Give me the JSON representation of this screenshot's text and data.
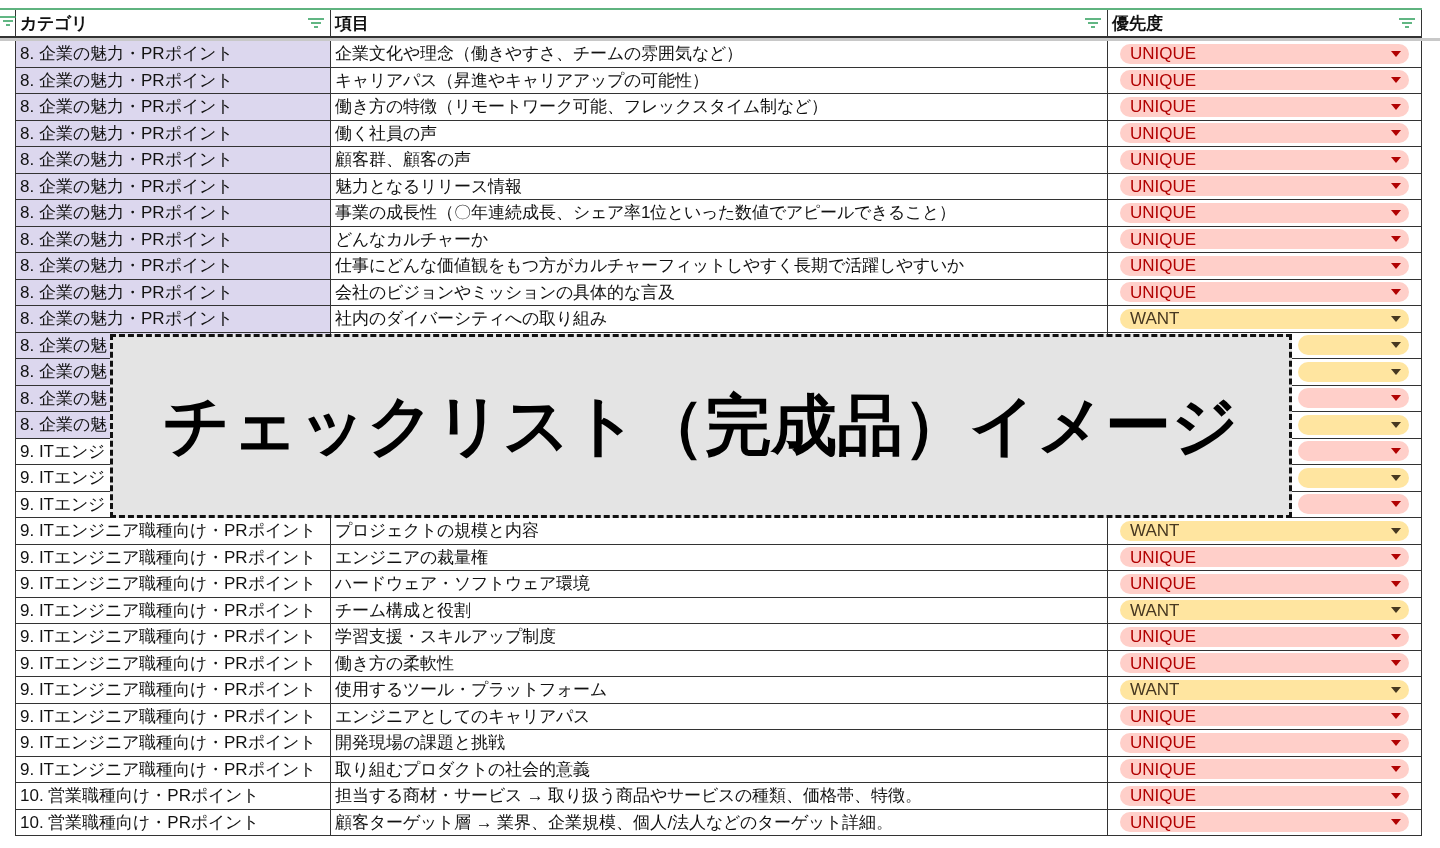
{
  "columns": [
    {
      "label": "カテゴリ"
    },
    {
      "label": "項目"
    },
    {
      "label": "優先度"
    }
  ],
  "rows": [
    {
      "category": "8. 企業の魅力・PRポイント",
      "color": "#dcd7ee",
      "item": "企業文化や理念（働きやすさ、チームの雰囲気など）",
      "priority": {
        "kind": "unique",
        "label": "UNIQUE"
      }
    },
    {
      "category": "8. 企業の魅力・PRポイント",
      "color": "#dcd7ee",
      "item": "キャリアパス（昇進やキャリアアップの可能性）",
      "priority": {
        "kind": "unique",
        "label": "UNIQUE"
      }
    },
    {
      "category": "8. 企業の魅力・PRポイント",
      "color": "#dcd7ee",
      "item": "働き方の特徴（リモートワーク可能、フレックスタイム制など）",
      "priority": {
        "kind": "unique",
        "label": "UNIQUE"
      }
    },
    {
      "category": "8. 企業の魅力・PRポイント",
      "color": "#dcd7ee",
      "item": "働く社員の声",
      "priority": {
        "kind": "unique",
        "label": "UNIQUE"
      }
    },
    {
      "category": "8. 企業の魅力・PRポイント",
      "color": "#dcd7ee",
      "item": "顧客群、顧客の声",
      "priority": {
        "kind": "unique",
        "label": "UNIQUE"
      }
    },
    {
      "category": "8. 企業の魅力・PRポイント",
      "color": "#dcd7ee",
      "item": "魅力となるリリース情報",
      "priority": {
        "kind": "unique",
        "label": "UNIQUE"
      }
    },
    {
      "category": "8. 企業の魅力・PRポイント",
      "color": "#dcd7ee",
      "item": "事業の成長性（〇年連続成長、シェア率1位といった数値でアピールできること）",
      "priority": {
        "kind": "unique",
        "label": "UNIQUE"
      }
    },
    {
      "category": "8. 企業の魅力・PRポイント",
      "color": "#dcd7ee",
      "item": "どんなカルチャーか",
      "priority": {
        "kind": "unique",
        "label": "UNIQUE"
      }
    },
    {
      "category": "8. 企業の魅力・PRポイント",
      "color": "#dcd7ee",
      "item": "仕事にどんな価値観をもつ方がカルチャーフィットしやすく長期で活躍しやすいか",
      "priority": {
        "kind": "unique",
        "label": "UNIQUE"
      }
    },
    {
      "category": "8. 企業の魅力・PRポイント",
      "color": "#dcd7ee",
      "item": "会社のビジョンやミッションの具体的な言及",
      "priority": {
        "kind": "unique",
        "label": "UNIQUE"
      }
    },
    {
      "category": "8. 企業の魅力・PRポイント",
      "color": "#dcd7ee",
      "item": "社内のダイバーシティへの取り組み",
      "priority": {
        "kind": "want",
        "label": "WANT"
      }
    },
    {
      "category": "8. 企業の魅",
      "color": "#dcd7ee",
      "priority": {
        "kind": "want"
      }
    },
    {
      "category": "8. 企業の魅",
      "color": "#dcd7ee",
      "priority": {
        "kind": "want"
      }
    },
    {
      "category": "8. 企業の魅",
      "color": "#dcd7ee",
      "priority": {
        "kind": "unique"
      }
    },
    {
      "category": "8. 企業の魅",
      "color": "#dcd7ee",
      "priority": {
        "kind": "want"
      }
    },
    {
      "category": "9. ITエンジ",
      "priority": {
        "kind": "unique"
      }
    },
    {
      "category": "9. ITエンジ",
      "priority": {
        "kind": "want"
      }
    },
    {
      "category": "9. ITエンジ",
      "priority": {
        "kind": "unique"
      }
    },
    {
      "category": "9. ITエンジニア職種向け・PRポイント",
      "color": "#ffffff",
      "item": "プロジェクトの規模と内容",
      "priority": {
        "kind": "want",
        "label": "WANT"
      }
    },
    {
      "category": "9. ITエンジニア職種向け・PRポイント",
      "color": "#ffffff",
      "item": "エンジニアの裁量権",
      "priority": {
        "kind": "unique",
        "label": "UNIQUE"
      }
    },
    {
      "category": "9. ITエンジニア職種向け・PRポイント",
      "color": "#ffffff",
      "item": "ハードウェア・ソフトウェア環境",
      "priority": {
        "kind": "unique",
        "label": "UNIQUE"
      }
    },
    {
      "category": "9. ITエンジニア職種向け・PRポイント",
      "color": "#ffffff",
      "item": "チーム構成と役割",
      "priority": {
        "kind": "want",
        "label": "WANT"
      }
    },
    {
      "category": "9. ITエンジニア職種向け・PRポイント",
      "color": "#ffffff",
      "item": "学習支援・スキルアップ制度",
      "priority": {
        "kind": "unique",
        "label": "UNIQUE"
      }
    },
    {
      "category": "9. ITエンジニア職種向け・PRポイント",
      "color": "#ffffff",
      "item": "働き方の柔軟性",
      "priority": {
        "kind": "unique",
        "label": "UNIQUE"
      }
    },
    {
      "category": "9. ITエンジニア職種向け・PRポイント",
      "color": "#ffffff",
      "item": "使用するツール・プラットフォーム",
      "priority": {
        "kind": "want",
        "label": "WANT"
      }
    },
    {
      "category": "9. ITエンジニア職種向け・PRポイント",
      "color": "#ffffff",
      "item": "エンジニアとしてのキャリアパス",
      "priority": {
        "kind": "unique",
        "label": "UNIQUE"
      }
    },
    {
      "category": "9. ITエンジニア職種向け・PRポイント",
      "color": "#ffffff",
      "item": "開発現場の課題と挑戦",
      "priority": {
        "kind": "unique",
        "label": "UNIQUE"
      }
    },
    {
      "category": "9. ITエンジニア職種向け・PRポイント",
      "color": "#ffffff",
      "item": "取り組むプロダクトの社会的意義",
      "priority": {
        "kind": "unique",
        "label": "UNIQUE"
      }
    },
    {
      "category": "10. 営業職種向け・PRポイント",
      "color": "#ffffff",
      "item": "担当する商材・サービス → 取り扱う商品やサービスの種類、価格帯、特徴。",
      "priority": {
        "kind": "unique",
        "label": "UNIQUE"
      }
    },
    {
      "category": "10. 営業職種向け・PRポイント",
      "color": "#ffffff",
      "item": "顧客ターゲット層 → 業界、企業規模、個人/法人などのターゲット詳細。",
      "priority": {
        "kind": "unique",
        "label": "UNIQUE"
      }
    }
  ],
  "overlay": {
    "title": "チェックリスト（完成品）イメージ"
  }
}
